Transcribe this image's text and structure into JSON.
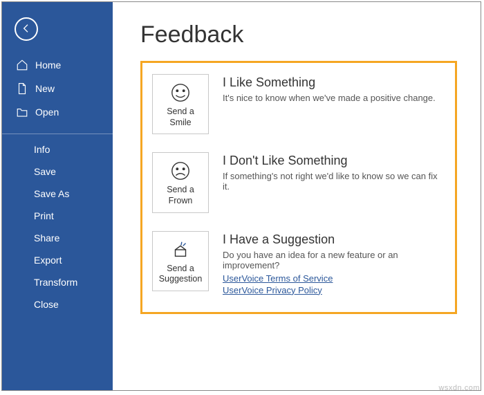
{
  "page_title": "Feedback",
  "nav": {
    "top": [
      {
        "id": "home",
        "label": "Home",
        "icon": "home-icon"
      },
      {
        "id": "new",
        "label": "New",
        "icon": "new-doc-icon"
      },
      {
        "id": "open",
        "label": "Open",
        "icon": "open-folder-icon"
      }
    ],
    "bottom": [
      {
        "id": "info",
        "label": "Info"
      },
      {
        "id": "save",
        "label": "Save"
      },
      {
        "id": "saveas",
        "label": "Save As"
      },
      {
        "id": "print",
        "label": "Print"
      },
      {
        "id": "share",
        "label": "Share"
      },
      {
        "id": "export",
        "label": "Export"
      },
      {
        "id": "transform",
        "label": "Transform"
      },
      {
        "id": "close",
        "label": "Close"
      }
    ]
  },
  "feedback": [
    {
      "tile_label": "Send a Smile",
      "title": "I Like Something",
      "desc": "It's nice to know when we've made a positive change.",
      "links": []
    },
    {
      "tile_label": "Send a Frown",
      "title": "I Don't Like Something",
      "desc": "If something's not right we'd like to know so we can fix it.",
      "links": []
    },
    {
      "tile_label": "Send a Suggestion",
      "title": "I Have a Suggestion",
      "desc": "Do you have an idea for a new feature or an improvement?",
      "links": [
        "UserVoice Terms of Service",
        "UserVoice Privacy Policy"
      ]
    }
  ],
  "watermark": "wsxdn.com"
}
